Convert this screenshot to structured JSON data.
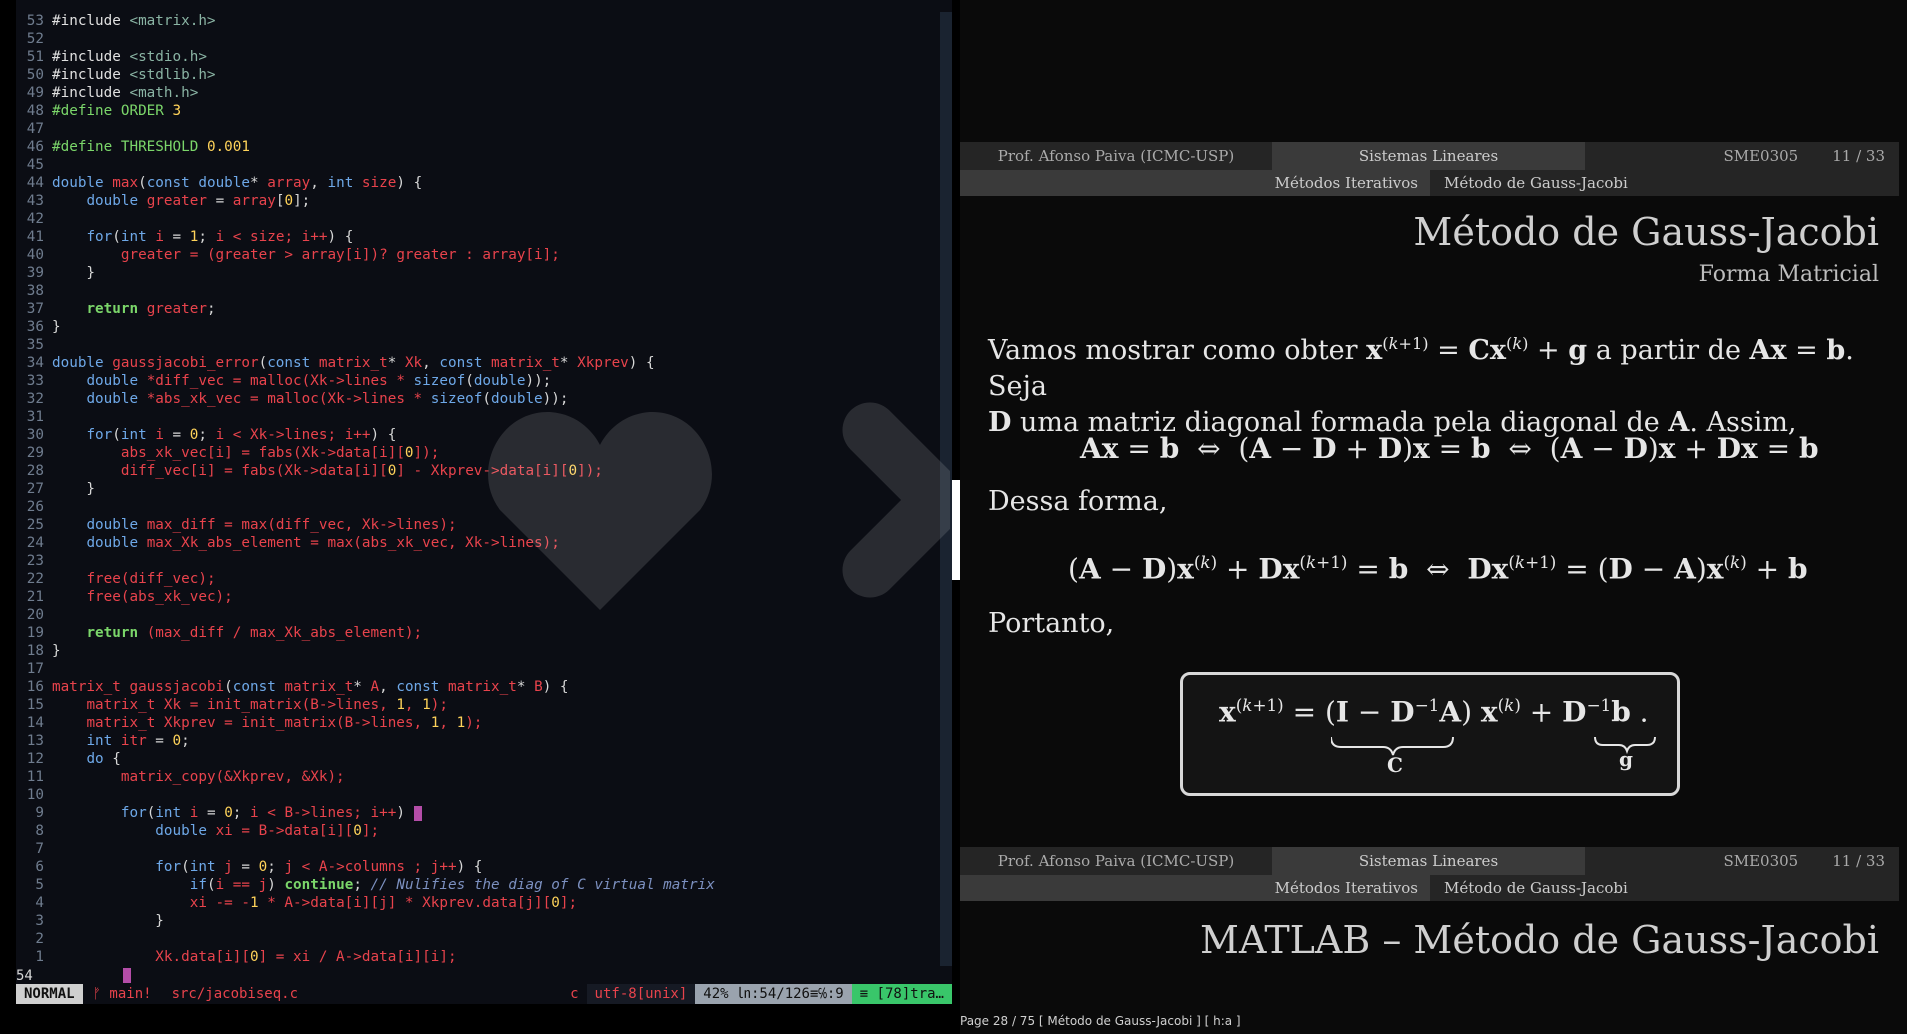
{
  "editor": {
    "lines": [
      {
        "n": "53",
        "t": [
          [
            "pp",
            "#include "
          ],
          [
            "str",
            "<matrix.h>"
          ]
        ]
      },
      {
        "n": "52",
        "t": []
      },
      {
        "n": "51",
        "t": [
          [
            "pp",
            "#include "
          ],
          [
            "str",
            "<stdio.h>"
          ]
        ]
      },
      {
        "n": "50",
        "t": [
          [
            "pp",
            "#include "
          ],
          [
            "str",
            "<stdlib.h>"
          ]
        ]
      },
      {
        "n": "49",
        "t": [
          [
            "pp",
            "#include "
          ],
          [
            "str",
            "<math.h>"
          ]
        ]
      },
      {
        "n": "48",
        "t": [
          [
            "mac",
            "#define ORDER "
          ],
          [
            "num",
            "3"
          ]
        ]
      },
      {
        "n": "47",
        "t": []
      },
      {
        "n": "46",
        "t": [
          [
            "mac",
            "#define THRESHOLD "
          ],
          [
            "num",
            "0.001"
          ]
        ]
      },
      {
        "n": "45",
        "t": []
      },
      {
        "n": "44",
        "t": [
          [
            "ty",
            "double "
          ],
          [
            "fn",
            "max"
          ],
          [
            "plain",
            "("
          ],
          [
            "ty",
            "const double"
          ],
          [
            "plain",
            "* "
          ],
          [
            "id",
            "array"
          ],
          [
            "plain",
            ", "
          ],
          [
            "ty",
            "int "
          ],
          [
            "id",
            "size"
          ],
          [
            "plain",
            ") {"
          ]
        ]
      },
      {
        "n": "43",
        "t": [
          [
            "plain",
            "    "
          ],
          [
            "ty",
            "double "
          ],
          [
            "id",
            "greater"
          ],
          [
            "plain",
            " = "
          ],
          [
            "id",
            "array"
          ],
          [
            "plain",
            "["
          ],
          [
            "num",
            "0"
          ],
          [
            "plain",
            "];"
          ]
        ]
      },
      {
        "n": "42",
        "t": []
      },
      {
        "n": "41",
        "t": [
          [
            "plain",
            "    "
          ],
          [
            "kw",
            "for"
          ],
          [
            "plain",
            "("
          ],
          [
            "ty",
            "int "
          ],
          [
            "id",
            "i"
          ],
          [
            "plain",
            " = "
          ],
          [
            "num",
            "1"
          ],
          [
            "plain",
            "; "
          ],
          [
            "id",
            "i < size; i++"
          ],
          [
            "plain",
            ") {"
          ]
        ]
      },
      {
        "n": "40",
        "t": [
          [
            "plain",
            "        "
          ],
          [
            "id",
            "greater = (greater > array[i])? greater : array[i];"
          ]
        ]
      },
      {
        "n": "39",
        "t": [
          [
            "plain",
            "    }"
          ]
        ]
      },
      {
        "n": "38",
        "t": []
      },
      {
        "n": "37",
        "t": [
          [
            "plain",
            "    "
          ],
          [
            "ctl",
            "return "
          ],
          [
            "id",
            "greater"
          ],
          [
            "plain",
            ";"
          ]
        ]
      },
      {
        "n": "36",
        "t": [
          [
            "plain",
            "}"
          ]
        ]
      },
      {
        "n": "35",
        "t": []
      },
      {
        "n": "34",
        "t": [
          [
            "ty",
            "double "
          ],
          [
            "fn",
            "gaussjacobi_error"
          ],
          [
            "plain",
            "("
          ],
          [
            "ty",
            "const "
          ],
          [
            "id",
            "matrix_t"
          ],
          [
            "plain",
            "* "
          ],
          [
            "id",
            "Xk"
          ],
          [
            "plain",
            ", "
          ],
          [
            "ty",
            "const "
          ],
          [
            "id",
            "matrix_t"
          ],
          [
            "plain",
            "* "
          ],
          [
            "id",
            "Xkprev"
          ],
          [
            "plain",
            ") {"
          ]
        ]
      },
      {
        "n": "33",
        "t": [
          [
            "plain",
            "    "
          ],
          [
            "ty",
            "double "
          ],
          [
            "id",
            "*diff_vec = malloc(Xk->lines * "
          ],
          [
            "kw",
            "sizeof"
          ],
          [
            "plain",
            "("
          ],
          [
            "ty",
            "double"
          ],
          [
            "plain",
            "));"
          ]
        ]
      },
      {
        "n": "32",
        "t": [
          [
            "plain",
            "    "
          ],
          [
            "ty",
            "double "
          ],
          [
            "id",
            "*abs_xk_vec = malloc(Xk->lines * "
          ],
          [
            "kw",
            "sizeof"
          ],
          [
            "plain",
            "("
          ],
          [
            "ty",
            "double"
          ],
          [
            "plain",
            "));"
          ]
        ]
      },
      {
        "n": "31",
        "t": []
      },
      {
        "n": "30",
        "t": [
          [
            "plain",
            "    "
          ],
          [
            "kw",
            "for"
          ],
          [
            "plain",
            "("
          ],
          [
            "ty",
            "int "
          ],
          [
            "id",
            "i"
          ],
          [
            "plain",
            " = "
          ],
          [
            "num",
            "0"
          ],
          [
            "plain",
            "; "
          ],
          [
            "id",
            "i < Xk->lines; i++"
          ],
          [
            "plain",
            ") {"
          ]
        ]
      },
      {
        "n": "29",
        "t": [
          [
            "plain",
            "        "
          ],
          [
            "id",
            "abs_xk_vec[i] = fabs(Xk->data[i]["
          ],
          [
            "num",
            "0"
          ],
          [
            "id",
            "]);"
          ]
        ]
      },
      {
        "n": "28",
        "t": [
          [
            "plain",
            "        "
          ],
          [
            "id",
            "diff_vec[i] = fabs(Xk->data[i]["
          ],
          [
            "num",
            "0"
          ],
          [
            "id",
            "] - Xkprev->data[i]["
          ],
          [
            "num",
            "0"
          ],
          [
            "id",
            "]);"
          ]
        ]
      },
      {
        "n": "27",
        "t": [
          [
            "plain",
            "    }"
          ]
        ]
      },
      {
        "n": "26",
        "t": []
      },
      {
        "n": "25",
        "t": [
          [
            "plain",
            "    "
          ],
          [
            "ty",
            "double "
          ],
          [
            "id",
            "max_diff = max(diff_vec, Xk->lines);"
          ]
        ]
      },
      {
        "n": "24",
        "t": [
          [
            "plain",
            "    "
          ],
          [
            "ty",
            "double "
          ],
          [
            "id",
            "max_Xk_abs_element = max(abs_xk_vec, Xk->lines);"
          ]
        ]
      },
      {
        "n": "23",
        "t": []
      },
      {
        "n": "22",
        "t": [
          [
            "plain",
            "    "
          ],
          [
            "id",
            "free(diff_vec);"
          ]
        ]
      },
      {
        "n": "21",
        "t": [
          [
            "plain",
            "    "
          ],
          [
            "id",
            "free(abs_xk_vec);"
          ]
        ]
      },
      {
        "n": "20",
        "t": []
      },
      {
        "n": "19",
        "t": [
          [
            "plain",
            "    "
          ],
          [
            "ctl",
            "return "
          ],
          [
            "id",
            "(max_diff / max_Xk_abs_element);"
          ]
        ]
      },
      {
        "n": "18",
        "t": [
          [
            "plain",
            "}"
          ]
        ]
      },
      {
        "n": "17",
        "t": []
      },
      {
        "n": "16",
        "t": [
          [
            "id",
            "matrix_t "
          ],
          [
            "fn",
            "gaussjacobi"
          ],
          [
            "plain",
            "("
          ],
          [
            "ty",
            "const "
          ],
          [
            "id",
            "matrix_t"
          ],
          [
            "plain",
            "* "
          ],
          [
            "id",
            "A"
          ],
          [
            "plain",
            ", "
          ],
          [
            "ty",
            "const "
          ],
          [
            "id",
            "matrix_t"
          ],
          [
            "plain",
            "* "
          ],
          [
            "id",
            "B"
          ],
          [
            "plain",
            ") {"
          ]
        ]
      },
      {
        "n": "15",
        "t": [
          [
            "plain",
            "    "
          ],
          [
            "id",
            "matrix_t Xk = init_matrix(B->lines, "
          ],
          [
            "num",
            "1"
          ],
          [
            "id",
            ", "
          ],
          [
            "num",
            "1"
          ],
          [
            "id",
            ");"
          ]
        ]
      },
      {
        "n": "14",
        "t": [
          [
            "plain",
            "    "
          ],
          [
            "id",
            "matrix_t Xkprev = init_matrix(B->lines, "
          ],
          [
            "num",
            "1"
          ],
          [
            "id",
            ", "
          ],
          [
            "num",
            "1"
          ],
          [
            "id",
            ");"
          ]
        ]
      },
      {
        "n": "13",
        "t": [
          [
            "plain",
            "    "
          ],
          [
            "ty",
            "int "
          ],
          [
            "id",
            "itr"
          ],
          [
            "plain",
            " = "
          ],
          [
            "num",
            "0"
          ],
          [
            "plain",
            ";"
          ]
        ]
      },
      {
        "n": "12",
        "t": [
          [
            "plain",
            "    "
          ],
          [
            "kw",
            "do "
          ],
          [
            "plain",
            "{"
          ]
        ]
      },
      {
        "n": "11",
        "t": [
          [
            "plain",
            "        "
          ],
          [
            "id",
            "matrix_copy(&Xkprev, &Xk);"
          ]
        ]
      },
      {
        "n": "10",
        "t": []
      },
      {
        "n": "9",
        "t": [
          [
            "plain",
            "        "
          ],
          [
            "kw",
            "for"
          ],
          [
            "plain",
            "("
          ],
          [
            "ty",
            "int "
          ],
          [
            "id",
            "i"
          ],
          [
            "plain",
            " = "
          ],
          [
            "num",
            "0"
          ],
          [
            "plain",
            "; "
          ],
          [
            "id",
            "i < B->lines; i++"
          ],
          [
            "plain",
            ") "
          ],
          [
            "cursor",
            ""
          ]
        ]
      },
      {
        "n": "8",
        "t": [
          [
            "plain",
            "            "
          ],
          [
            "ty",
            "double "
          ],
          [
            "id",
            "xi = B->data[i]["
          ],
          [
            "num",
            "0"
          ],
          [
            "id",
            "];"
          ]
        ]
      },
      {
        "n": "7",
        "t": []
      },
      {
        "n": "6",
        "t": [
          [
            "plain",
            "            "
          ],
          [
            "kw",
            "for"
          ],
          [
            "plain",
            "("
          ],
          [
            "ty",
            "int "
          ],
          [
            "id",
            "j"
          ],
          [
            "plain",
            " = "
          ],
          [
            "num",
            "0"
          ],
          [
            "plain",
            "; "
          ],
          [
            "id",
            "j < A->columns ; j++"
          ],
          [
            "plain",
            ") {"
          ]
        ]
      },
      {
        "n": "5",
        "t": [
          [
            "plain",
            "                "
          ],
          [
            "kw",
            "if"
          ],
          [
            "plain",
            "("
          ],
          [
            "id",
            "i == j"
          ],
          [
            "plain",
            ") "
          ],
          [
            "ctl",
            "continue"
          ],
          [
            "plain",
            "; "
          ],
          [
            "com",
            "// Nulifies the diag of C virtual matrix"
          ]
        ]
      },
      {
        "n": "4",
        "t": [
          [
            "plain",
            "                "
          ],
          [
            "id",
            "xi -= -"
          ],
          [
            "num",
            "1"
          ],
          [
            "id",
            " * A->data[i][j] * Xkprev.data[j]["
          ],
          [
            "num",
            "0"
          ],
          [
            "id",
            "];"
          ]
        ]
      },
      {
        "n": "3",
        "t": [
          [
            "plain",
            "            }"
          ]
        ]
      },
      {
        "n": "2",
        "t": []
      },
      {
        "n": "1",
        "t": [
          [
            "plain",
            "            "
          ],
          [
            "id",
            "Xk.data[i]["
          ],
          [
            "num",
            "0"
          ],
          [
            "id",
            "] = xi / A->data[i][i];"
          ]
        ]
      }
    ],
    "cmdline": "54",
    "status": {
      "mode": "NORMAL",
      "branch": "ᚠ main!",
      "file": "src/jacobiseq.c",
      "filetype": "c",
      "encoding": "utf-8[unix]",
      "position": "42% ㏑:54/126≡℅:9",
      "whitespace": "≡ [78]tra…"
    }
  },
  "viewer": {
    "header": {
      "author": "Prof. Afonso Paiva  (ICMC-USP)",
      "course": "Sistemas Lineares",
      "code": "SME0305",
      "page": "11 / 33",
      "section": "Métodos Iterativos",
      "subsection": "Método de Gauss-Jacobi"
    },
    "title": "Método de Gauss-Jacobi",
    "subtitle": "Forma Matricial",
    "para1_a": "Vamos mostrar como obter",
    "para1_b": "a partir de",
    "para1_c": ". Seja",
    "para1_d": "uma matriz diagonal formada pela diagonal de",
    "para1_e": ". Assim,",
    "dessa": "Dessa forma,",
    "portanto": "Portanto,",
    "label_C": "C",
    "label_g": "g",
    "next_title": "MATLAB – Método de Gauss-Jacobi",
    "pdf_status": "Page 28 / 75 [ Método de Gauss-Jacobi ]  [ h:a ]"
  }
}
